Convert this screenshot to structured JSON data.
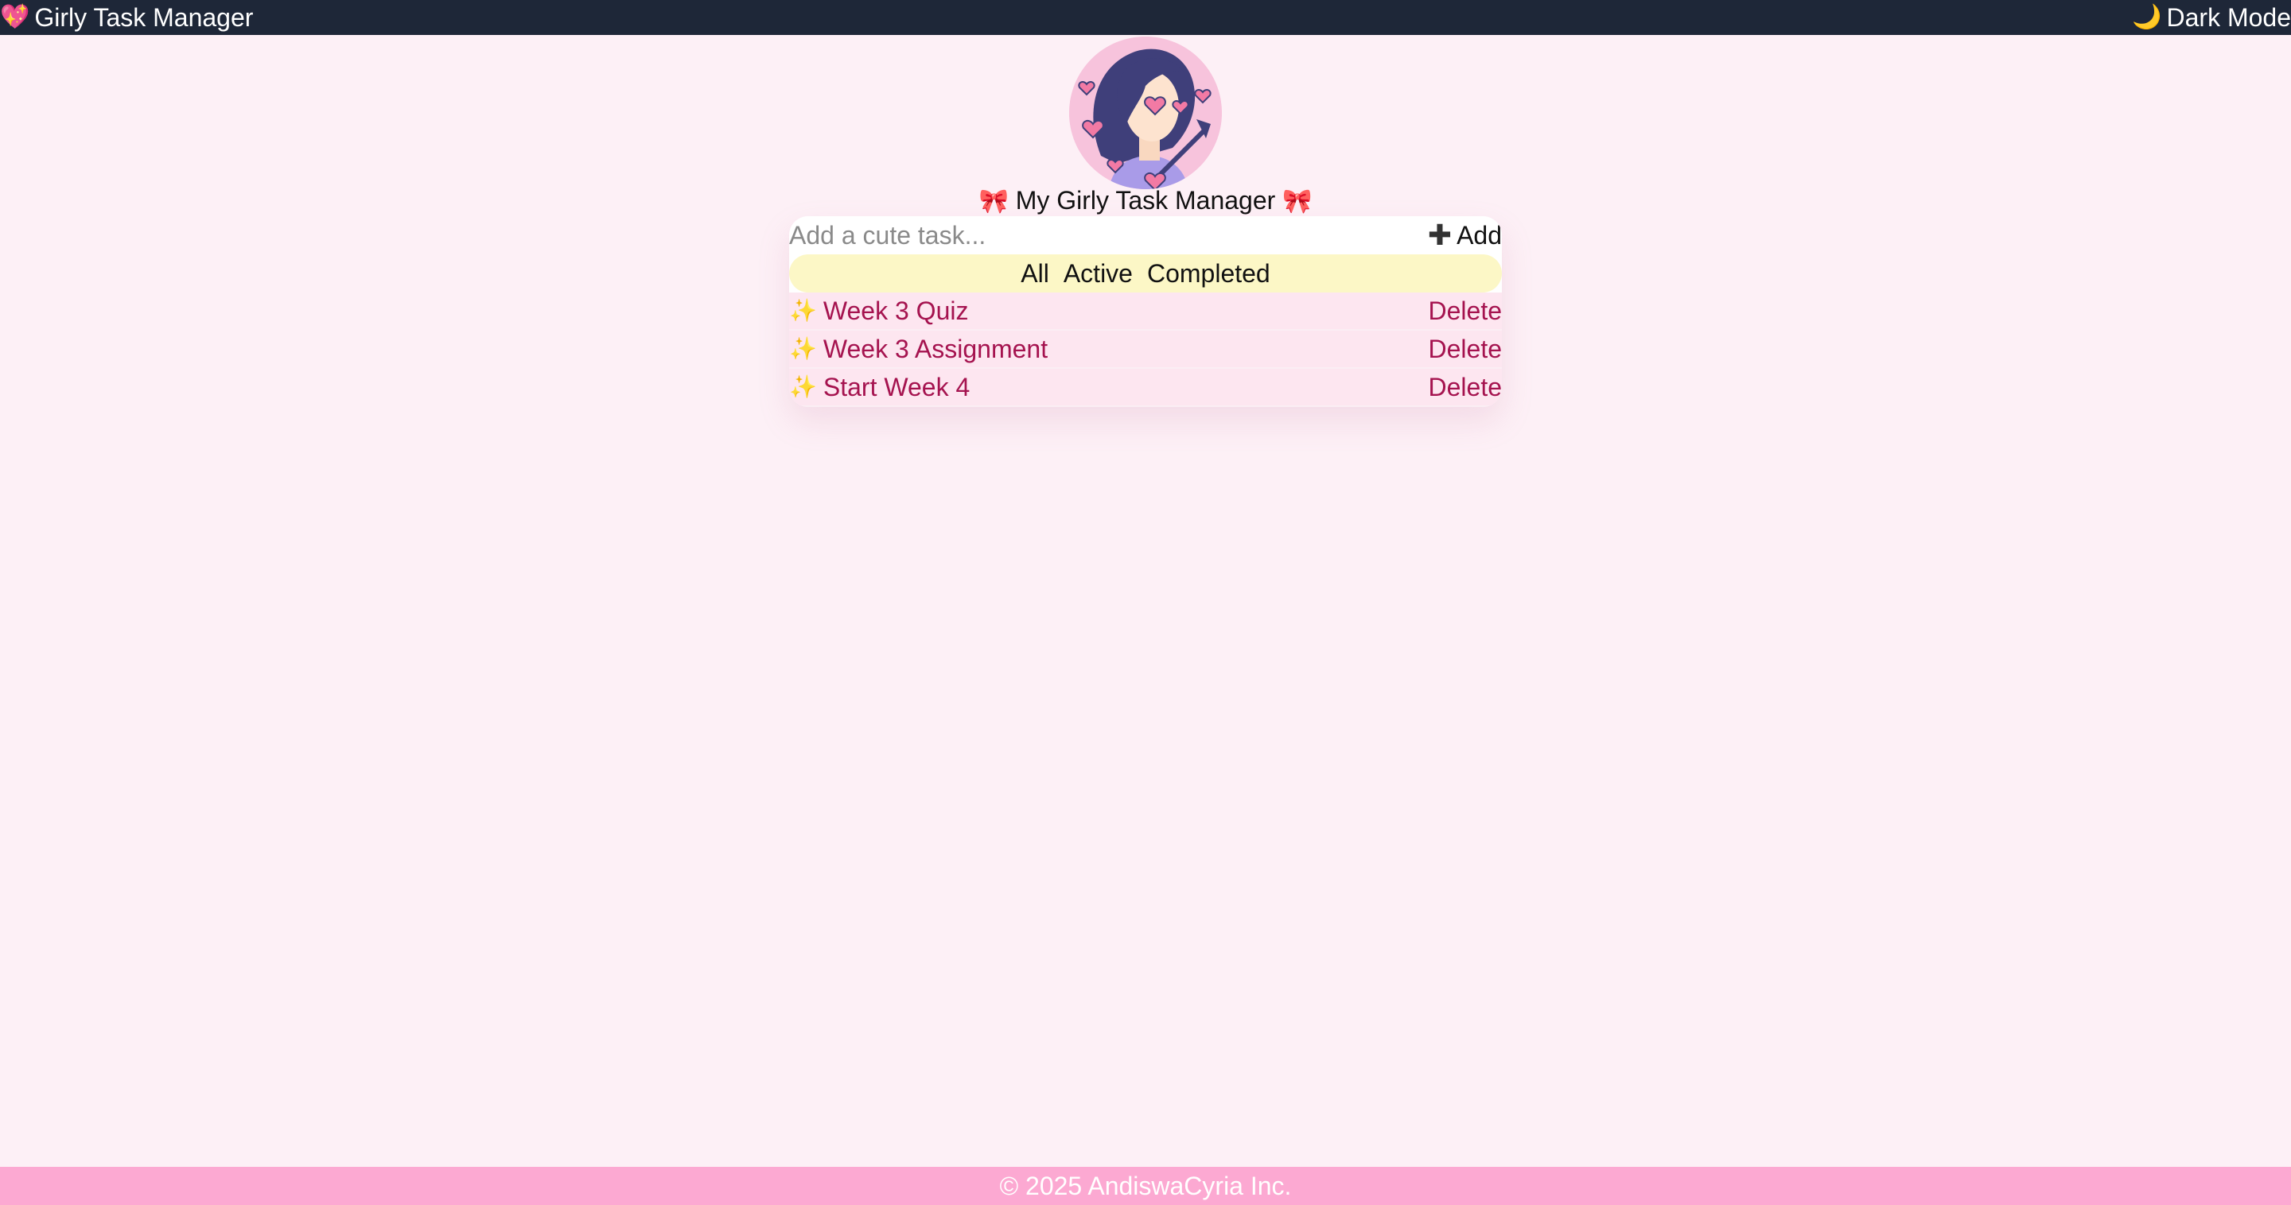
{
  "navbar": {
    "brand_icon": "💖",
    "brand_label": "Girly Task Manager",
    "darkmode_icon": "🌙",
    "darkmode_label": "Dark Mode"
  },
  "header": {
    "ribbon_icon": "🎀",
    "title": "My Girly Task Manager"
  },
  "task_form": {
    "placeholder": "Add a cute task...",
    "value": "",
    "add_label": "Add",
    "add_icon": "plus-icon"
  },
  "filters": [
    "All",
    "Active",
    "Completed"
  ],
  "tasks": [
    {
      "icon": "✨",
      "title": "Week 3 Quiz",
      "action": "Delete"
    },
    {
      "icon": "✨",
      "title": "Week 3 Assignment",
      "action": "Delete"
    },
    {
      "icon": "✨",
      "title": "Start Week 4",
      "action": "Delete"
    }
  ],
  "footer": {
    "text": "© 2025 AndiswaCyria Inc."
  },
  "colors": {
    "navbar_bg": "#1e2738",
    "page_bg": "#fdf0f6",
    "filter_bg": "#fcf7c6",
    "task_bg": "#fde6f0",
    "task_text": "#a5134f",
    "footer_bg": "#fca9d2"
  }
}
